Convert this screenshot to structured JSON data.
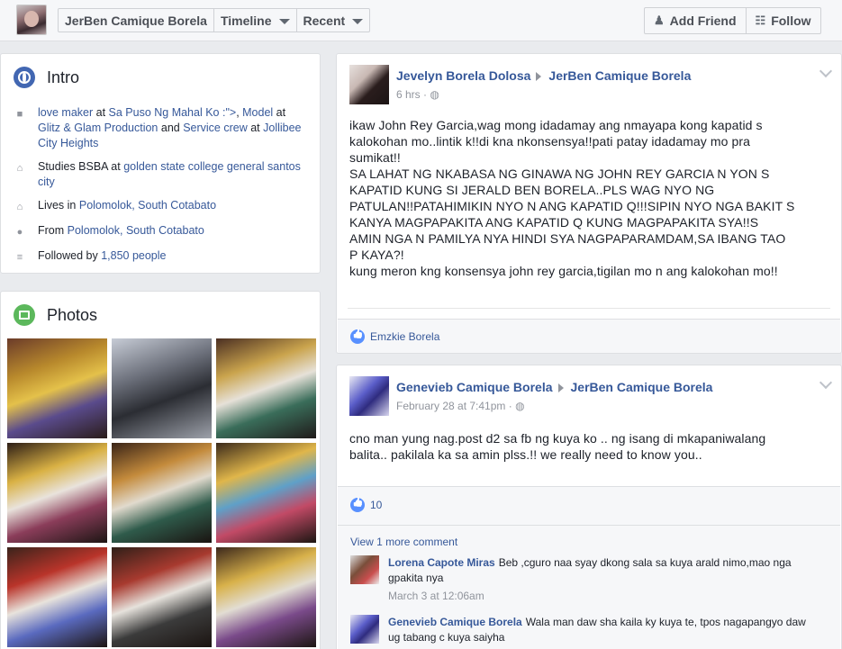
{
  "topbar": {
    "profile_name": "JerBen Camique Borela",
    "timeline_label": "Timeline",
    "recent_label": "Recent",
    "add_friend_label": "Add Friend",
    "follow_label": "Follow"
  },
  "intro": {
    "title": "Intro",
    "work_lead": "love maker",
    "work_at1": " at ",
    "work_place1": "Sa Puso Ng Mahal Ko :\">",
    "work_sep": ", ",
    "work_role2": "Model",
    "work_at2": " at ",
    "work_place2": "Glitz & Glam Production",
    "work_and": " and ",
    "work_role3": "Service crew",
    "work_at3": " at ",
    "work_place3": "Jollibee City Heights",
    "study_lead": "Studies BSBA at ",
    "study_place": "golden state college general santos city",
    "lives_lead": "Lives in ",
    "lives_place": "Polomolok, South Cotabato",
    "from_lead": "From ",
    "from_place": "Polomolok, South Cotabato",
    "followed_lead": "Followed by ",
    "followed_count": "1,850 people"
  },
  "photos": {
    "title": "Photos"
  },
  "post1": {
    "author": "Jevelyn Borela Dolosa",
    "target": "JerBen Camique Borela",
    "time": "6 hrs",
    "body": [
      "ikaw John Rey Garcia,wag mong idadamay ang nmayapa kong kapatid s",
      "kalokohan mo..lintik k!!di kna nkonsensya!!pati patay idadamay mo pra",
      "sumikat!!",
      "SA LAHAT NG NKABASA NG GINAWA NG JOHN REY GARCIA N YON S",
      "KAPATID KUNG SI JERALD BEN BORELA..PLS WAG NYO NG",
      "PATULAN!!PATAHIMIKIN NYO N ANG KAPATID Q!!!SIPIN NYO NGA BAKIT S",
      "KANYA MAGPAPAKITA ANG KAPATID Q KUNG MAGPAPAKITA SYA!!S",
      "AMIN NGA N PAMILYA NYA HINDI SYA NAGPAPARAMDAM,SA IBANG TAO",
      "P KAYA?!",
      "kung meron kng konsensya john rey garcia,tigilan mo n ang kalokohan mo!!"
    ],
    "liker": "Emzkie Borela"
  },
  "post2": {
    "author": "Genevieb Camique Borela",
    "target": "JerBen Camique Borela",
    "time": "February 28 at 7:41pm",
    "body": [
      "cno man yung nag.post d2 sa fb ng kuya ko .. ng isang di mkapaniwalang",
      "balita.. pakilala ka sa amin plss.!! we really need to know you.."
    ],
    "like_count": "10",
    "view_more": "View 1 more comment",
    "comments": [
      {
        "name": "Lorena Capote Miras",
        "text": "Beb ,cguro naa syay dkong sala sa kuya arald nimo,mao nga gpakita nya",
        "time": "March 3 at 12:06am"
      },
      {
        "name": "Genevieb Camique Borela",
        "text": "Wala man daw sha kaila ky kuya te, tpos nagapangyo daw ug tabang c kuya saiyha",
        "time": ""
      }
    ]
  }
}
